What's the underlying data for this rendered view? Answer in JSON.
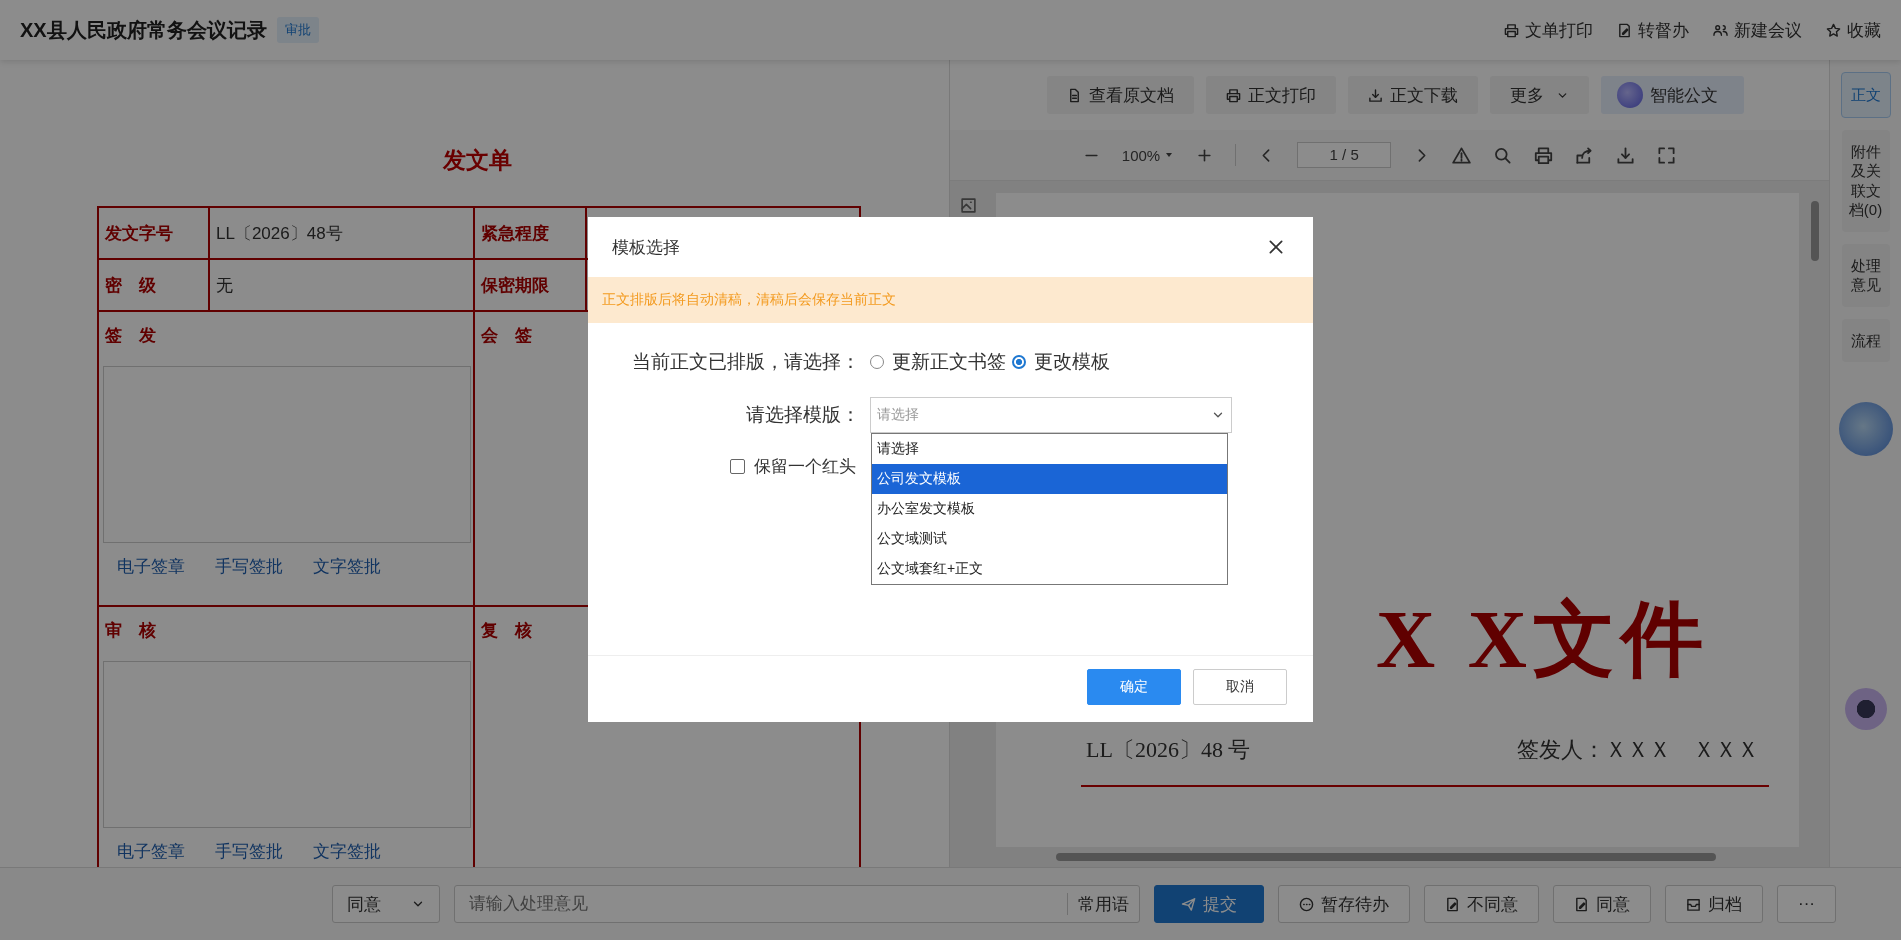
{
  "header": {
    "title": "XX县人民政府常务会议记录",
    "badge": "审批",
    "actions": [
      {
        "label": "文单打印"
      },
      {
        "label": "转督办"
      },
      {
        "label": "新建会议"
      },
      {
        "label": "收藏"
      }
    ]
  },
  "form": {
    "title": "发文单",
    "info_rows": [
      {
        "cells": [
          {
            "label": "发文字号",
            "value": "LL〔2026〕48号"
          },
          {
            "label": "紧急程度"
          }
        ]
      },
      {
        "cells": [
          {
            "label": "密　级",
            "value": "无"
          },
          {
            "label": "保密期限"
          }
        ]
      }
    ],
    "sections": [
      {
        "left": {
          "label": "签　发",
          "actions": [
            "电子签章",
            "手写签批",
            "文字签批"
          ]
        },
        "right": {
          "label": "会　签"
        }
      },
      {
        "left": {
          "label": "审　核",
          "actions": [
            "电子签章",
            "手写签批",
            "文字签批"
          ]
        },
        "right": {
          "label": "复　核"
        }
      }
    ]
  },
  "doc_toolbar": [
    {
      "label": "查看原文档",
      "kind": "plain"
    },
    {
      "label": "正文打印",
      "kind": "plain"
    },
    {
      "label": "正文下载",
      "kind": "plain"
    },
    {
      "label": "更多",
      "kind": "menu"
    },
    {
      "label": "智能公文",
      "kind": "ai"
    }
  ],
  "viewer": {
    "zoom": "100%",
    "page": "1 / 5"
  },
  "document": {
    "heading": "X X文件",
    "number": "LL〔2026〕48 号",
    "signer": "签发人：ＸＸＸ　ＸＸＸ"
  },
  "sidebar_tabs": [
    {
      "label": "正文",
      "selected": true
    },
    {
      "label": "附件及关联文档(0)",
      "selected": false
    },
    {
      "label": "处理意见",
      "selected": false
    },
    {
      "label": "流程",
      "selected": false
    }
  ],
  "bottom_bar": {
    "opinion_select": {
      "value": "同意"
    },
    "opinion_input": {
      "placeholder": "请输入处理意见"
    },
    "phrases_button": "常用语",
    "actions": [
      {
        "label": "提交",
        "kind": "primary"
      },
      {
        "label": "暂存待办",
        "kind": "default"
      },
      {
        "label": "不同意",
        "kind": "default"
      },
      {
        "label": "同意",
        "kind": "default"
      },
      {
        "label": "归档",
        "kind": "default"
      },
      {
        "label": "···",
        "kind": "default"
      }
    ]
  },
  "dialog": {
    "title": "模板选择",
    "notice": "正文排版后将自动清稿，清稿后会保存当前正文",
    "mode_label": "当前正文已排版，请选择：",
    "mode_options": [
      {
        "label": "更新正文书签",
        "selected": false
      },
      {
        "label": "更改模板",
        "selected": true
      }
    ],
    "template_label": "请选择模版：",
    "template_select": {
      "placeholder": "请选择",
      "expanded": true,
      "options": [
        {
          "label": "请选择",
          "selected": false
        },
        {
          "label": "公司发文模板",
          "selected": true
        },
        {
          "label": "办公室发文模板",
          "selected": false
        },
        {
          "label": "公文域测试",
          "selected": false
        },
        {
          "label": "公文域套红+正文",
          "selected": false
        }
      ]
    },
    "keep_header": {
      "label": "保留一个红头",
      "checked": false
    },
    "buttons": [
      {
        "label": "确定",
        "kind": "primary"
      },
      {
        "label": "取消",
        "kind": "default"
      }
    ]
  }
}
